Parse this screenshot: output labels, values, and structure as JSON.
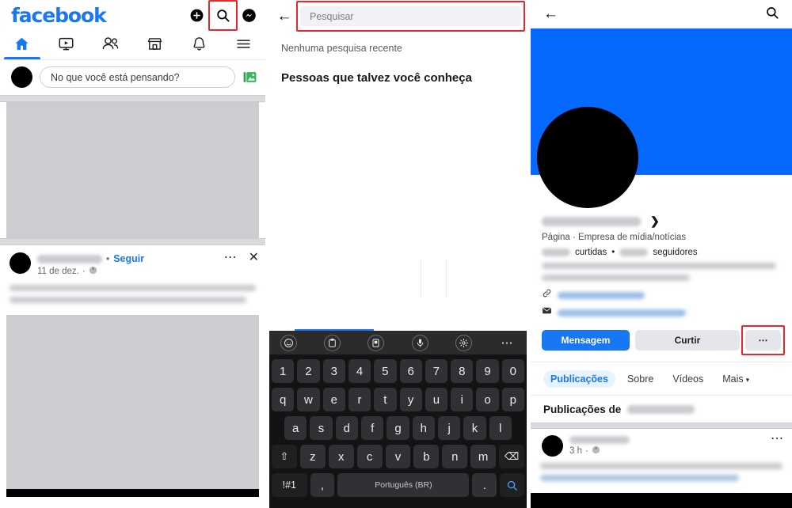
{
  "meta": {
    "highlight_color": "#e8262c",
    "facebook_blue": "#1877F2",
    "cover_blue": "#0669FF"
  },
  "panel1": {
    "name": "facebook-feed",
    "brand": "facebook",
    "topbar_icons": [
      {
        "name": "add-icon",
        "glyph": "+"
      },
      {
        "name": "search-icon",
        "glyph": "search",
        "highlighted": true
      },
      {
        "name": "messenger-icon",
        "glyph": "messenger"
      }
    ],
    "nav_tabs": [
      {
        "name": "home",
        "icon": "home-icon",
        "active": true
      },
      {
        "name": "video",
        "icon": "video-icon",
        "active": false
      },
      {
        "name": "friends",
        "icon": "friends-icon",
        "active": false
      },
      {
        "name": "marketplace",
        "icon": "marketplace-icon",
        "active": false
      },
      {
        "name": "notifications",
        "icon": "bell-icon",
        "active": false
      },
      {
        "name": "menu",
        "icon": "hamburger-menu-icon",
        "active": false
      }
    ],
    "composer": {
      "placeholder": "No que você está pensando?",
      "photo_icon": "photo-gallery-icon"
    },
    "post": {
      "follow_label": "Seguir",
      "separator_dot": "•",
      "date": "11 de dez.",
      "privacy_icon": "globe-icon",
      "more_icon": "⋯",
      "close_icon": "✕"
    }
  },
  "panel2": {
    "name": "facebook-search",
    "back_icon": "back-arrow-icon",
    "search_placeholder": "Pesquisar",
    "no_recent": "Nenhuma pesquisa recente",
    "suggestions_heading": "Pessoas que talvez você conheça",
    "keyboard": {
      "toolbar": [
        {
          "name": "emoji-icon",
          "glyph": "☺"
        },
        {
          "name": "clipboard-icon",
          "glyph": "clipboard"
        },
        {
          "name": "sticker-icon",
          "glyph": "sticker"
        },
        {
          "name": "microphone-icon",
          "glyph": "mic"
        },
        {
          "name": "settings-gear-icon",
          "glyph": "gear"
        },
        {
          "name": "more-options-icon",
          "glyph": "⋯"
        }
      ],
      "row_numbers": [
        "1",
        "2",
        "3",
        "4",
        "5",
        "6",
        "7",
        "8",
        "9",
        "0"
      ],
      "row_q": [
        "q",
        "w",
        "e",
        "r",
        "t",
        "y",
        "u",
        "i",
        "o",
        "p"
      ],
      "row_a": [
        "a",
        "s",
        "d",
        "f",
        "g",
        "h",
        "j",
        "k",
        "l"
      ],
      "shift_key": "⇧",
      "row_z": [
        "z",
        "x",
        "c",
        "v",
        "b",
        "n",
        "m"
      ],
      "backspace_key": "⌫",
      "symbols_key": "!#1",
      "comma_key": ",",
      "space_label": "Português (BR)",
      "period_key": ".",
      "enter_search_key": "search-icon"
    }
  },
  "panel3": {
    "name": "facebook-page-profile",
    "back_icon": "back-arrow-icon",
    "search_icon": "search-icon",
    "chevron": "❯",
    "category": "Página · Empresa de mídia/notícias",
    "likes_label": "curtidas",
    "stats_dot": "•",
    "followers_label": "seguidores",
    "contact_rows": [
      {
        "icon": "link-icon"
      },
      {
        "icon": "email-icon"
      }
    ],
    "buttons": {
      "message": "Mensagem",
      "like": "Curtir",
      "more": "⋯",
      "more_highlighted": true
    },
    "tabs": [
      {
        "label": "Publicações",
        "active": true
      },
      {
        "label": "Sobre",
        "active": false
      },
      {
        "label": "Vídeos",
        "active": false
      },
      {
        "label": "Mais",
        "active": false,
        "caret": "▾"
      }
    ],
    "posts_title": "Publicações de",
    "post": {
      "time": "3 h",
      "privacy_icon": "globe-icon",
      "more_icon": "⋯"
    }
  }
}
